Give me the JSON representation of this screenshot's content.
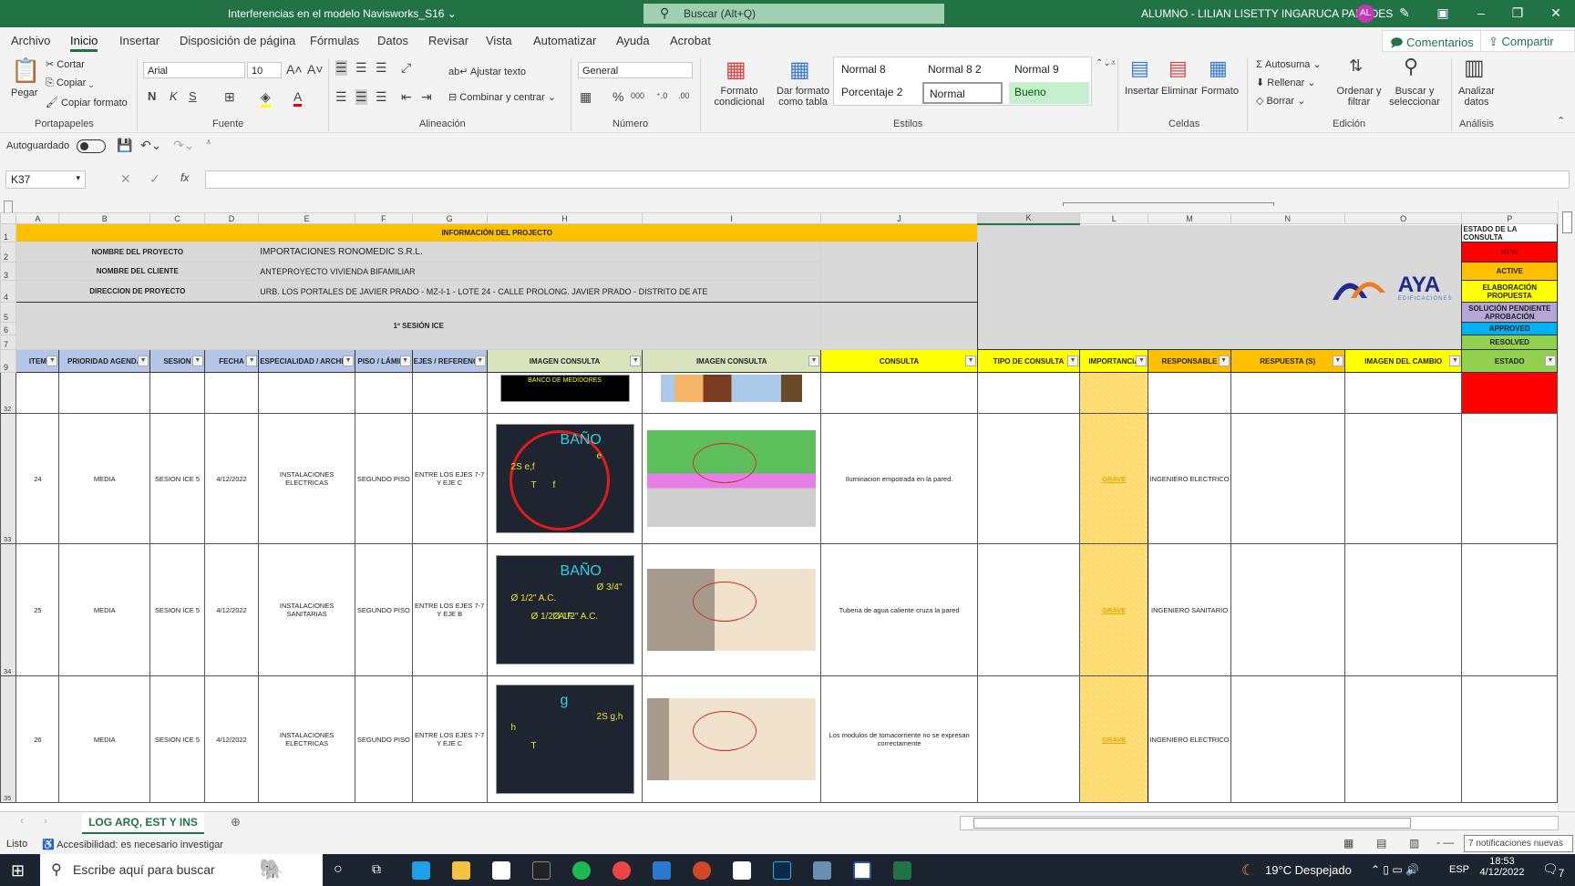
{
  "titlebar": {
    "doc_title": "Interferencias en el modelo Navisworks_S16 ⌄",
    "search_placeholder": "Buscar (Alt+Q)",
    "user": "ALUMNO - LILIAN LISETTY INGARUCA PAREDES",
    "avatar": "AL"
  },
  "menu": {
    "tabs": [
      "Archivo",
      "Inicio",
      "Insertar",
      "Disposición de página",
      "Fórmulas",
      "Datos",
      "Revisar",
      "Vista",
      "Automatizar",
      "Ayuda",
      "Acrobat"
    ],
    "active": "Inicio",
    "comments": "Comentarios",
    "share": "Compartir"
  },
  "ribbon": {
    "clipboard": {
      "paste": "Pegar",
      "cut": "Cortar",
      "copy": "Copiar",
      "format_painter": "Copiar formato",
      "label": "Portapapeles"
    },
    "font": {
      "name": "Arial",
      "size": "10",
      "bold": "N",
      "italic": "K",
      "underline": "S",
      "label": "Fuente"
    },
    "alignment": {
      "wrap": "Ajustar texto",
      "merge": "Combinar y centrar",
      "label": "Alineación"
    },
    "number": {
      "format": "General",
      "label": "Número"
    },
    "styles": {
      "conditional": "Formato condicional",
      "as_table": "Dar formato como tabla",
      "items": [
        "Normal 8",
        "Normal 8 2",
        "Normal 9",
        "Porcentaje 2",
        "Normal",
        "Bueno"
      ],
      "label": "Estilos"
    },
    "cells": {
      "insert": "Insertar",
      "delete": "Eliminar",
      "format": "Formato",
      "label": "Celdas"
    },
    "editing": {
      "autosum": "Autosuma",
      "fill": "Rellenar",
      "clear": "Borrar",
      "sort": "Ordenar y filtrar",
      "find": "Buscar y seleccionar",
      "label": "Edición"
    },
    "analysis": {
      "analyze": "Analizar datos",
      "label": "Análisis"
    }
  },
  "qat": {
    "autosave": "Autoguardado",
    "autosave_on": false
  },
  "formula_bar": {
    "cell": "K37",
    "fx": "fx",
    "value": ""
  },
  "columns": [
    "A",
    "B",
    "C",
    "D",
    "E",
    "F",
    "G",
    "H",
    "I",
    "J",
    "K",
    "L",
    "M",
    "N",
    "O",
    "P"
  ],
  "info": {
    "title": "INFORMACIÓN DEL PROJECTO",
    "project_label": "NOMBRE DEL PROYECTO",
    "project_value": "IMPORTACIONES RONOMEDIC S.R.L.",
    "client_label": "NOMBRE DEL CLIENTE",
    "client_value": "ANTEPROYECTO VIVIENDA BIFAMILIAR",
    "address_label": "DIRECCION DE PROYECTO",
    "address_value": "URB. LOS PORTALES DE JAVIER PRADO - MZ-I-1 - LOTE 24 - CALLE PROLONG. JAVIER PRADO - DISTRITO DE ATE",
    "session": "1º SESIÓN ICE",
    "logo": "AYA",
    "logo_sub": "EDIFICACIONES"
  },
  "legend": {
    "title": "ESTADO DE LA CONSULTA",
    "items": [
      {
        "label": "NEW",
        "color": "#ff0000"
      },
      {
        "label": "ACTIVE",
        "color": "#ffc000"
      },
      {
        "label": "ELABORACIÓN PROPUESTA",
        "color": "#ffff00"
      },
      {
        "label": "SOLUCIÓN PENDIENTE APROBACIÓN",
        "color": "#b4a7d6"
      },
      {
        "label": "APPROVED",
        "color": "#00b0f0"
      },
      {
        "label": "RESOLVED",
        "color": "#92d050"
      }
    ]
  },
  "row_numbers": [
    "1",
    "2",
    "3",
    "4",
    "5",
    "6",
    "7",
    "9",
    "32",
    "33",
    "34",
    "35"
  ],
  "headers": [
    "ITEM",
    "PRIORIDAD AGENDA",
    "SESION",
    "FECHA",
    "ESPECIALIDAD / ARCHIVO",
    "PISO / LÁMINA",
    "EJES / REFERENCIA",
    "IMAGEN CONSULTA",
    "IMAGEN CONSULTA",
    "CONSULTA",
    "TIPO DE CONSULTA",
    "IMPORTANCIA",
    "RESPONSABLE",
    "RESPUESTA (S)",
    "IMAGEN DEL CAMBIO",
    "ESTADO"
  ],
  "partial_row": {
    "image_text": "BANCO DE MEDIDORES",
    "estado_color": "#ff0000"
  },
  "rows": [
    {
      "item": "24",
      "prioridad": "MEDIA",
      "sesion": "SESION ICE 5",
      "fecha": "4/12/2022",
      "especialidad": "INSTALACIONES ELECTRICAS",
      "piso": "SEGUNDO PISO",
      "ejes": "ENTRE LOS EJES 7-7 Y EJE C",
      "cad_texts": [
        "BAÑO",
        "2S e,f",
        "e",
        "T",
        "f"
      ],
      "consulta": "Iluminacion empotrada en la pared.",
      "importancia": "GRAVE",
      "responsable": "INGENIERO ELECTRICO"
    },
    {
      "item": "25",
      "prioridad": "MEDIA",
      "sesion": "SESION ICE 5",
      "fecha": "4/12/2022",
      "especialidad": "INSTALACIONES SANITARIAS",
      "piso": "SEGUNDO PISO",
      "ejes": "ENTRE LOS EJES 7-7 Y EJE B",
      "cad_texts": [
        "BAÑO",
        "Ø 1/2\" A.C.",
        "Ø 3/4\"",
        "Ø 1/2\" A.F.",
        "Ø 1/2\" A.C."
      ],
      "consulta": "Tuberia de agua caliente cruza la pared",
      "importancia": "GRAVE",
      "responsable": "INGENIERO SANITARIO"
    },
    {
      "item": "26",
      "prioridad": "MEDIA",
      "sesion": "SESION ICE 5",
      "fecha": "4/12/2022",
      "especialidad": "INSTALACIONES ELECTRICAS",
      "piso": "SEGUNDO PISO",
      "ejes": "ENTRE LOS EJES 7-7 Y EJE C",
      "cad_texts": [
        "g",
        "h",
        "2S g,h",
        "T"
      ],
      "consulta": "Los modulos de tomacorriente no se expresan correctamente",
      "importancia": "GRAVE",
      "responsable": "INGENIERO ELECTRICO"
    }
  ],
  "sheet_tabs": [
    "LOG ARQ, EST Y INS"
  ],
  "status": {
    "ready": "Listo",
    "accessibility": "Accesibilidad: es necesario investigar",
    "notifications": "7 notificaciones nuevas"
  },
  "taskbar": {
    "search": "Escribe aquí para buscar",
    "weather": "19°C  Despejado",
    "lang": "ESP",
    "time": "18:53",
    "date": "4/12/2022",
    "badge": "7"
  }
}
